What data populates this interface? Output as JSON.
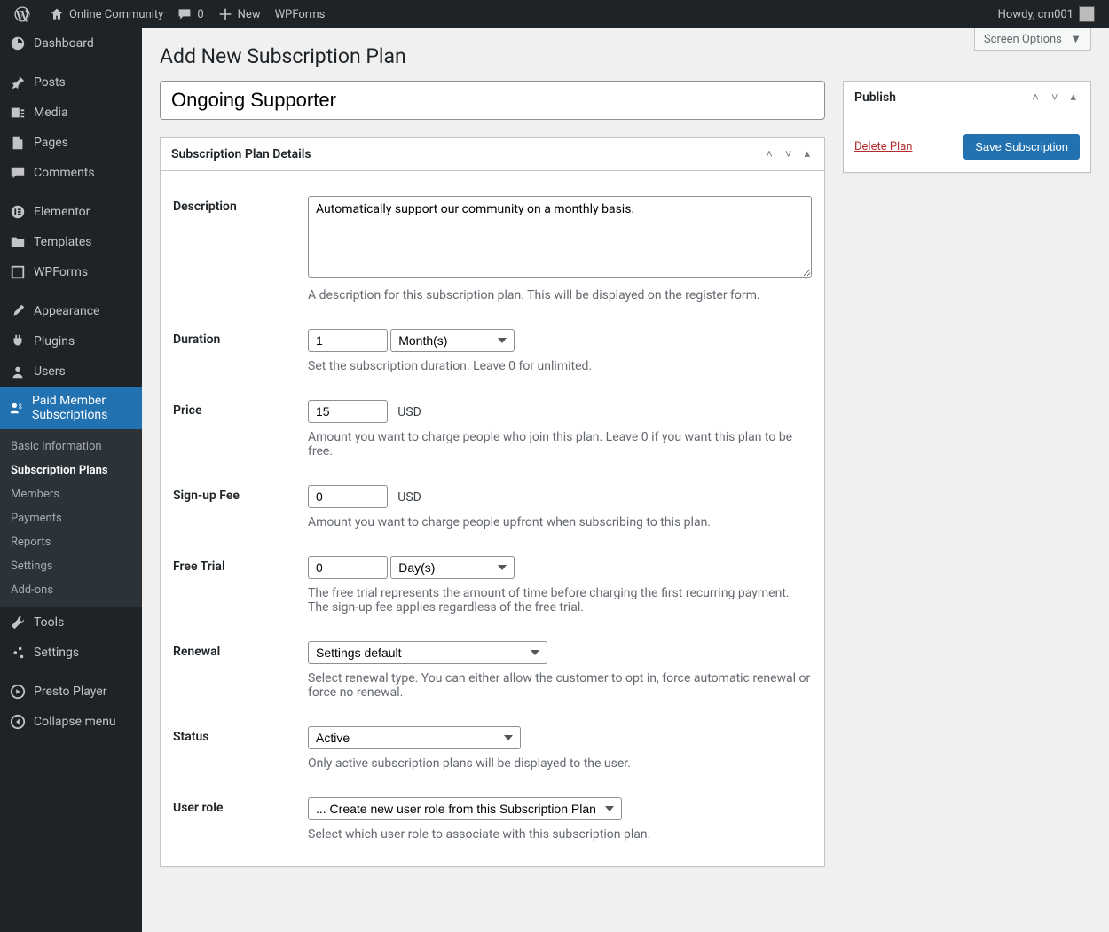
{
  "toolbar": {
    "site_name": "Online Community",
    "comments_count": "0",
    "new_label": "New",
    "wpforms_label": "WPForms",
    "howdy": "Howdy, crn001"
  },
  "sidebar": {
    "items": [
      {
        "label": "Dashboard"
      },
      {
        "label": "Posts"
      },
      {
        "label": "Media"
      },
      {
        "label": "Pages"
      },
      {
        "label": "Comments"
      },
      {
        "label": "Elementor"
      },
      {
        "label": "Templates"
      },
      {
        "label": "WPForms"
      },
      {
        "label": "Appearance"
      },
      {
        "label": "Plugins"
      },
      {
        "label": "Users"
      },
      {
        "label": "Paid Member Subscriptions"
      },
      {
        "label": "Tools"
      },
      {
        "label": "Settings"
      },
      {
        "label": "Presto Player"
      },
      {
        "label": "Collapse menu"
      }
    ],
    "submenu": [
      "Basic Information",
      "Subscription Plans",
      "Members",
      "Payments",
      "Reports",
      "Settings",
      "Add-ons"
    ]
  },
  "screen_options": "Screen Options",
  "page_title": "Add New Subscription Plan",
  "title_input": "Ongoing Supporter",
  "details": {
    "box_title": "Subscription Plan Details",
    "description_label": "Description",
    "description_value": "Automatically support our community on a monthly basis.",
    "description_help": "A description for this subscription plan. This will be displayed on the register form.",
    "duration_label": "Duration",
    "duration_value": "1",
    "duration_unit": "Month(s)",
    "duration_help": "Set the subscription duration. Leave 0 for unlimited.",
    "price_label": "Price",
    "price_value": "15",
    "price_currency": "USD",
    "price_help": "Amount you want to charge people who join this plan. Leave 0 if you want this plan to be free.",
    "signup_label": "Sign-up Fee",
    "signup_value": "0",
    "signup_currency": "USD",
    "signup_help": "Amount you want to charge people upfront when subscribing to this plan.",
    "trial_label": "Free Trial",
    "trial_value": "0",
    "trial_unit": "Day(s)",
    "trial_help": "The free trial represents the amount of time before charging the first recurring payment. The sign-up fee applies regardless of the free trial.",
    "renewal_label": "Renewal",
    "renewal_value": "Settings default",
    "renewal_help": "Select renewal type. You can either allow the customer to opt in, force automatic renewal or force no renewal.",
    "status_label": "Status",
    "status_value": "Active",
    "status_help": "Only active subscription plans will be displayed to the user.",
    "role_label": "User role",
    "role_value": "... Create new user role from this Subscription Plan",
    "role_help": "Select which user role to associate with this subscription plan."
  },
  "publish": {
    "box_title": "Publish",
    "delete": "Delete Plan",
    "save": "Save Subscription"
  }
}
